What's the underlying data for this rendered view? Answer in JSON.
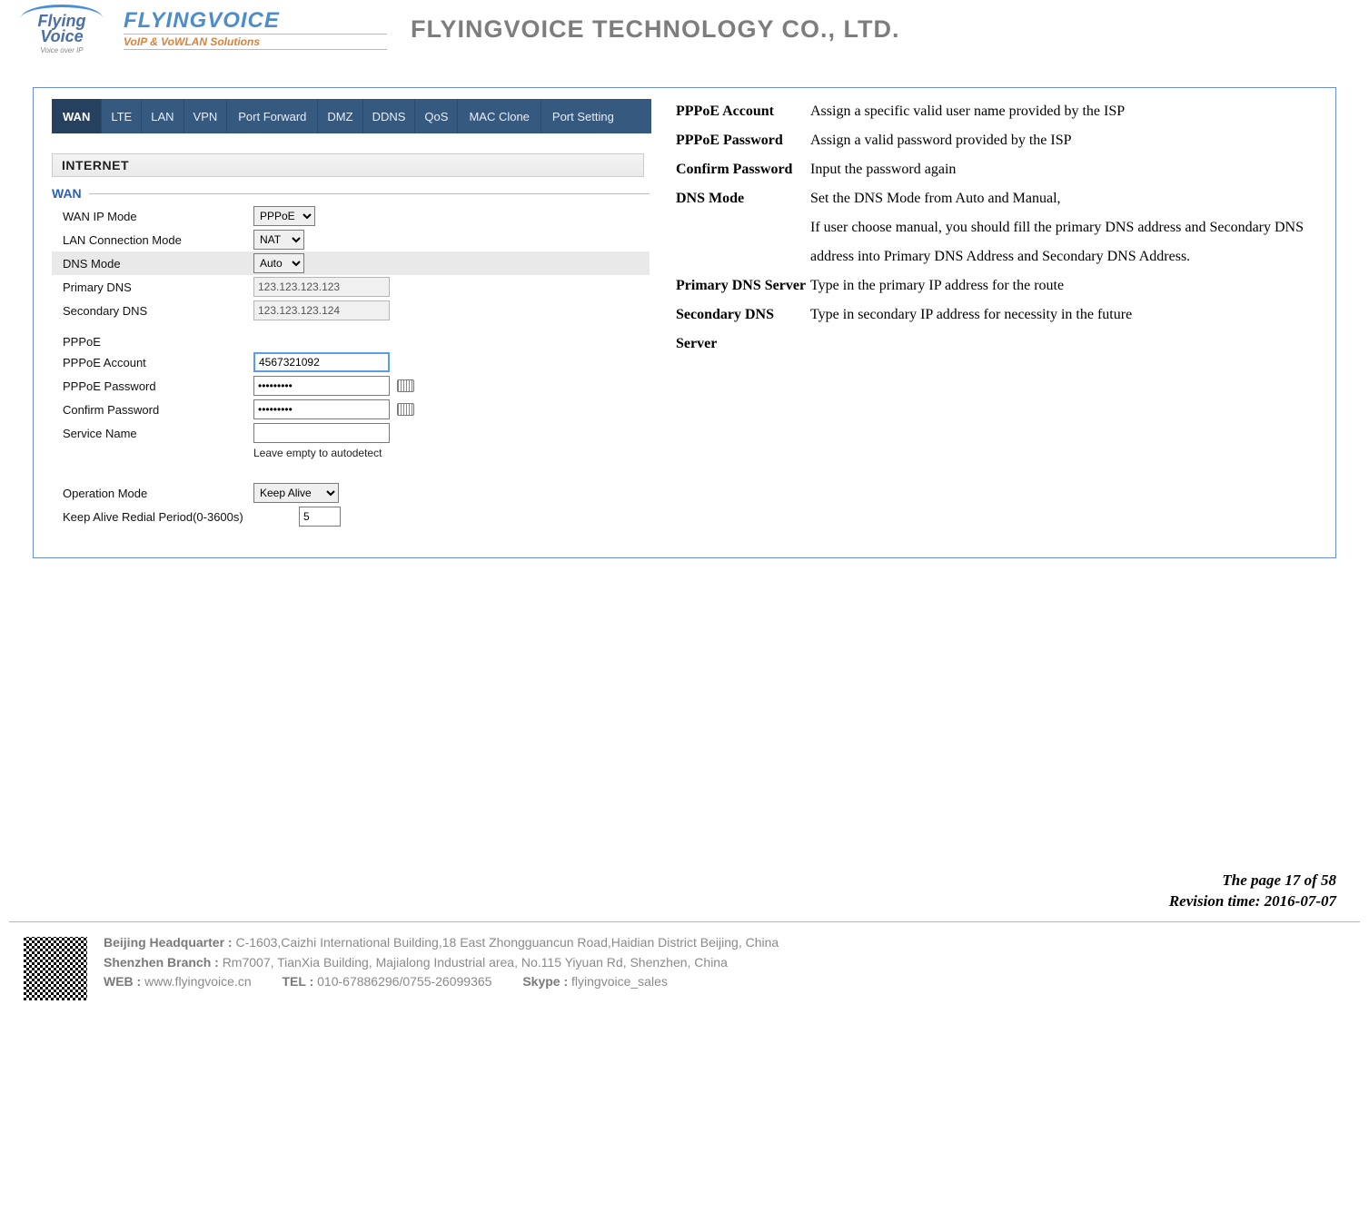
{
  "header": {
    "logo1_top": "Flying",
    "logo1_bot": "Voice",
    "logo1_sub": "Voice over IP",
    "logo2_top": "FLYINGVOICE",
    "logo2_bot": "VoIP & VoWLAN Solutions",
    "company": "FLYINGVOICE TECHNOLOGY CO., LTD."
  },
  "tabs": [
    "WAN",
    "LTE",
    "LAN",
    "VPN",
    "Port Forward",
    "DMZ",
    "DDNS",
    "QoS",
    "MAC Clone",
    "Port Setting"
  ],
  "active_tab_index": 0,
  "internet_label": "INTERNET",
  "wan_section": "WAN",
  "form": {
    "wan_ip_mode_label": "WAN IP Mode",
    "wan_ip_mode_value": "PPPoE",
    "lan_conn_mode_label": "LAN Connection Mode",
    "lan_conn_mode_value": "NAT",
    "dns_mode_label": "DNS Mode",
    "dns_mode_value": "Auto",
    "primary_dns_label": "Primary DNS",
    "primary_dns_value": "123.123.123.123",
    "secondary_dns_label": "Secondary DNS",
    "secondary_dns_value": "123.123.123.124",
    "pppoe_header": "PPPoE",
    "pppoe_account_label": "PPPoE Account",
    "pppoe_account_value": "4567321092",
    "pppoe_password_label": "PPPoE Password",
    "pppoe_password_value": "•••••••••",
    "confirm_password_label": "Confirm Password",
    "confirm_password_value": "•••••••••",
    "service_name_label": "Service Name",
    "service_name_value": "",
    "service_name_hint": "Leave empty to autodetect",
    "operation_mode_label": "Operation Mode",
    "operation_mode_value": "Keep Alive",
    "keep_alive_label": "Keep Alive Redial Period(0-3600s)",
    "keep_alive_value": "5"
  },
  "descriptions": [
    {
      "label": "PPPoE Account",
      "text": "Assign a specific valid user name provided by the ISP"
    },
    {
      "label": "PPPoE Password",
      "text": "Assign a valid password provided by the ISP"
    },
    {
      "label": "Confirm Password",
      "text": "Input the password again"
    },
    {
      "label": "DNS Mode",
      "text": "Set the DNS Mode from Auto and Manual,\nIf user choose manual, you should fill the primary DNS address and Secondary DNS address into Primary DNS Address and Secondary DNS Address."
    },
    {
      "label": "Primary DNS Server",
      "text": "Type in the primary IP address for the route"
    },
    {
      "label": "Secondary DNS Server",
      "text": "Type in secondary IP address for necessity in the future"
    }
  ],
  "footer": {
    "page": "The page 17 of 58",
    "revision": "Revision time: 2016-07-07",
    "hq_label": "Beijing Headquarter  :",
    "hq": "C-1603,Caizhi International Building,18 East Zhongguancun Road,Haidian District Beijing, China",
    "branch_label": "Shenzhen Branch :",
    "branch": "Rm7007, TianXia Building, Majialong Industrial area, No.115 Yiyuan Rd, Shenzhen, China",
    "web_label": "WEB :",
    "web": "www.flyingvoice.cn",
    "tel_label": "TEL :",
    "tel": "010-67886296/0755-26099365",
    "skype_label": "Skype :",
    "skype": "flyingvoice_sales"
  }
}
